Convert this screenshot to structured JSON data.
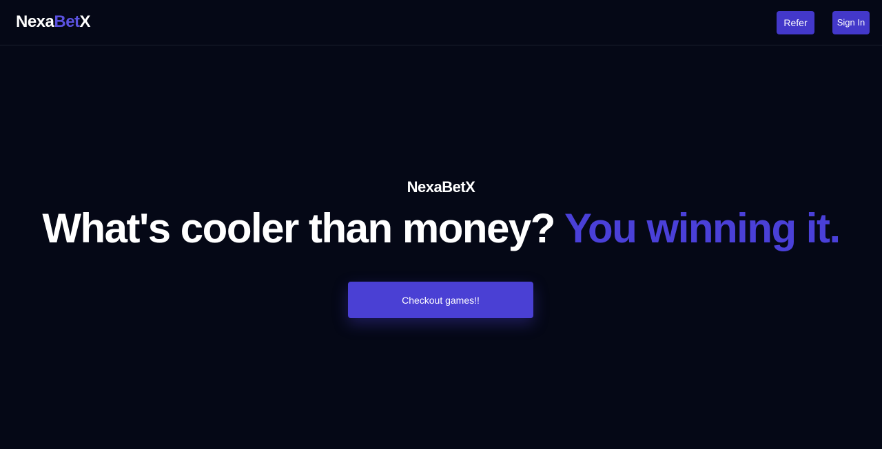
{
  "header": {
    "logo_main": "Nexa",
    "logo_accent": "Bet",
    "logo_end": "X",
    "refer_label": "Refer",
    "signin_label": "Sign In"
  },
  "hero": {
    "brand": "NexaBetX",
    "title_main": "What's cooler than money?",
    "title_accent": "You winning it.",
    "cta_label": "Checkout games!!"
  },
  "colors": {
    "background": "#050816",
    "accent": "#4a40d8",
    "button": "#4338ca"
  }
}
